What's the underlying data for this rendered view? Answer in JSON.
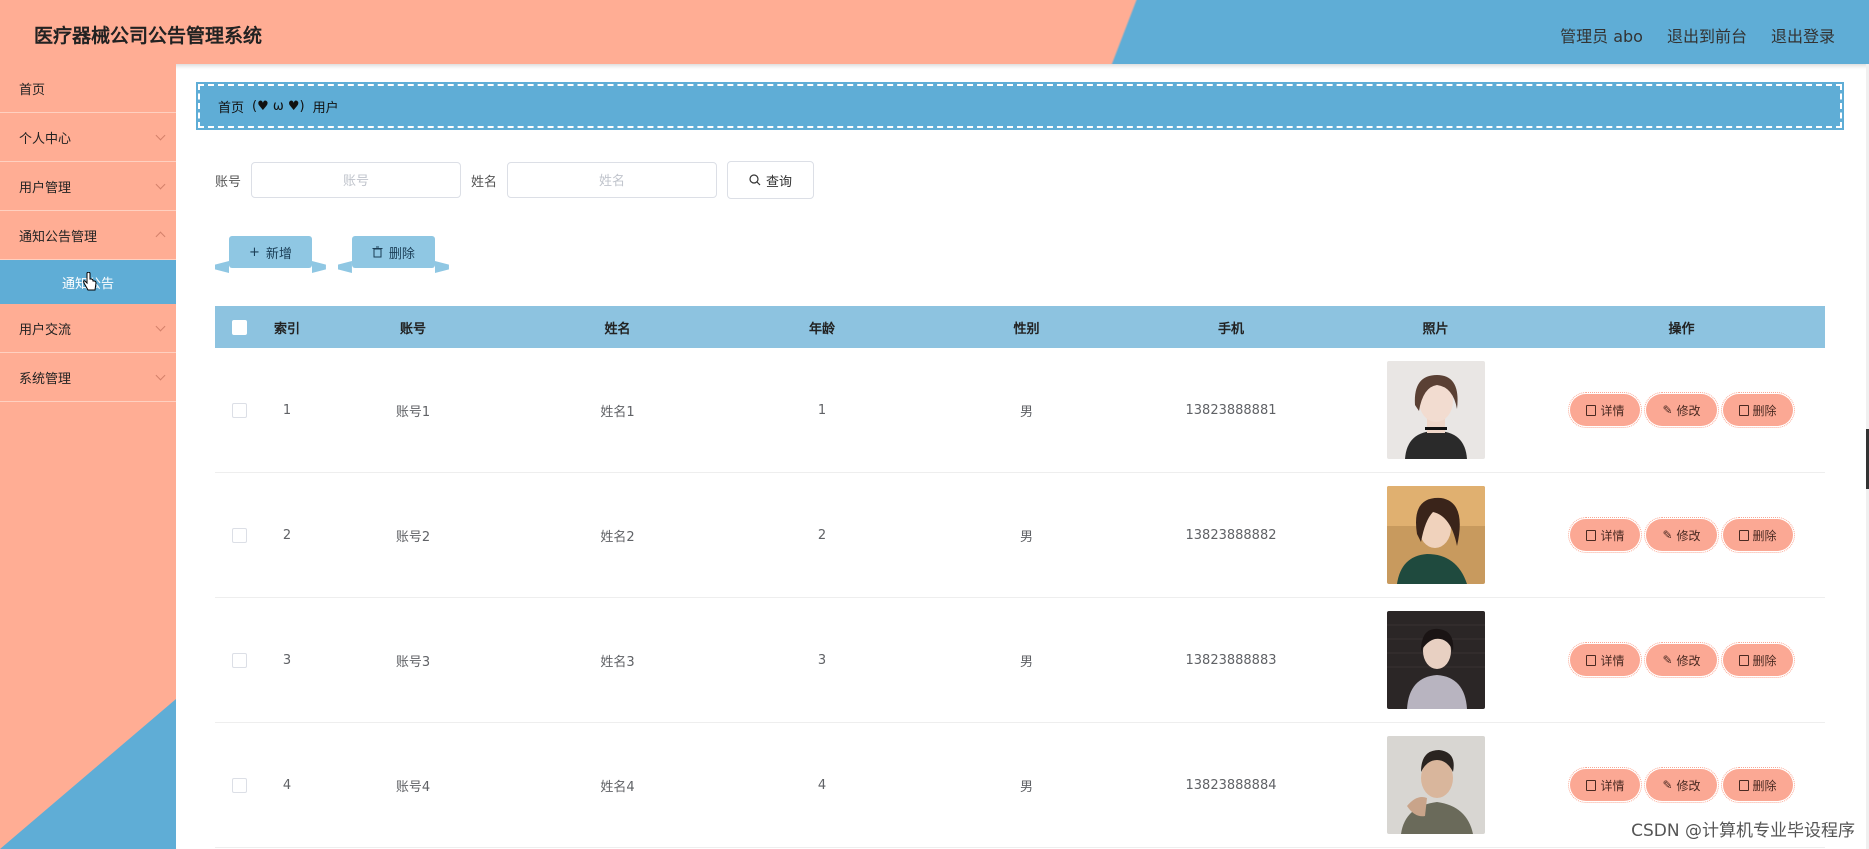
{
  "header": {
    "title": "医疗器械公司公告管理系统",
    "nav": [
      "管理员 abo",
      "退出到前台",
      "退出登录"
    ]
  },
  "sidebar": {
    "items": [
      {
        "label": "首页",
        "has_children": false
      },
      {
        "label": "个人中心",
        "has_children": true
      },
      {
        "label": "用户管理",
        "has_children": true
      },
      {
        "label": "通知公告管理",
        "has_children": true,
        "expanded": true,
        "children": [
          "通知公告"
        ]
      },
      {
        "label": "用户交流",
        "has_children": true
      },
      {
        "label": "系统管理",
        "has_children": true
      }
    ]
  },
  "breadcrumb": {
    "home": "首页",
    "separator": "(♥ ω ♥)",
    "current": "用户"
  },
  "search": {
    "account_label": "账号",
    "account_placeholder": "账号",
    "name_label": "姓名",
    "name_placeholder": "姓名",
    "query_button": "查询"
  },
  "actions": {
    "add_label": "新增",
    "delete_label": "删除"
  },
  "table": {
    "headers": [
      "索引",
      "账号",
      "姓名",
      "年龄",
      "性别",
      "手机",
      "照片",
      "操作"
    ],
    "rows": [
      {
        "index": "1",
        "account": "账号1",
        "name": "姓名1",
        "age": "1",
        "sex": "男",
        "phone": "13823888881",
        "photo": "photo-woman-1"
      },
      {
        "index": "2",
        "account": "账号2",
        "name": "姓名2",
        "age": "2",
        "sex": "男",
        "phone": "13823888882",
        "photo": "photo-woman-2"
      },
      {
        "index": "3",
        "account": "账号3",
        "name": "姓名3",
        "age": "3",
        "sex": "男",
        "phone": "13823888883",
        "photo": "photo-man-1"
      },
      {
        "index": "4",
        "account": "账号4",
        "name": "姓名4",
        "age": "4",
        "sex": "男",
        "phone": "13823888884",
        "photo": "photo-man-2"
      }
    ],
    "row_actions": {
      "detail": "详情",
      "edit": "修改",
      "delete": "删除"
    }
  },
  "watermark": "CSDN @计算机专业毕设程序",
  "colors": {
    "salmon": "#ffad94",
    "blue": "#5fadd6",
    "table_header": "#8dc3e0",
    "op_button": "#fba894"
  }
}
